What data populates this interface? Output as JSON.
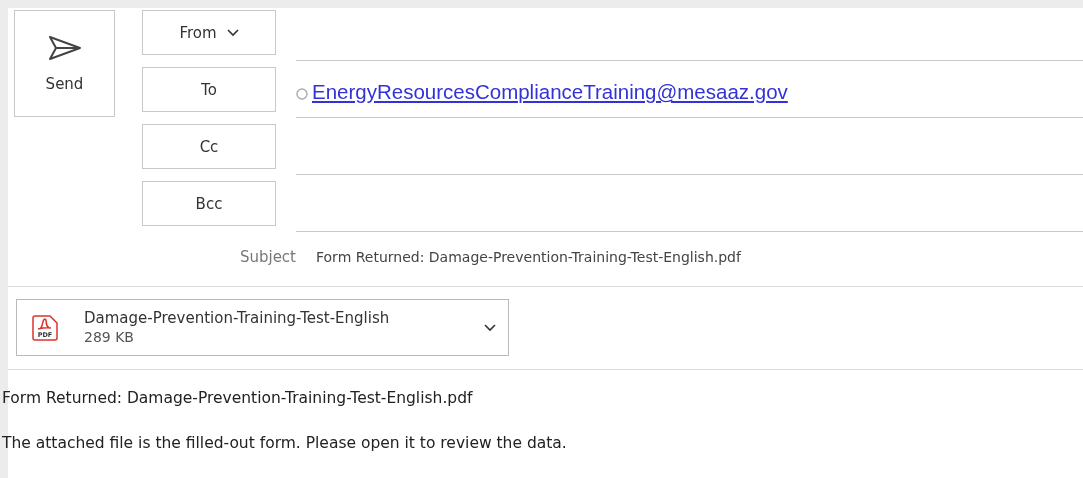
{
  "send_button": {
    "label": "Send"
  },
  "address_fields": [
    {
      "kind": "dropdown",
      "label": "From"
    },
    {
      "kind": "plain",
      "label": "To",
      "value": "EnergyResourcesComplianceTraining@mesaaz.gov"
    },
    {
      "kind": "plain",
      "label": "Cc"
    },
    {
      "kind": "plain",
      "label": "Bcc"
    }
  ],
  "subject": {
    "label": "Subject",
    "value": "Form Returned: Damage-Prevention-Training-Test-English.pdf"
  },
  "attachment": {
    "name": "Damage-Prevention-Training-Test-English",
    "size": "289 KB",
    "file_type": "PDF"
  },
  "body": [
    "Form Returned: Damage-Prevention-Training-Test-English.pdf",
    "The attached file is the filled-out form. Please open it to review the data."
  ]
}
